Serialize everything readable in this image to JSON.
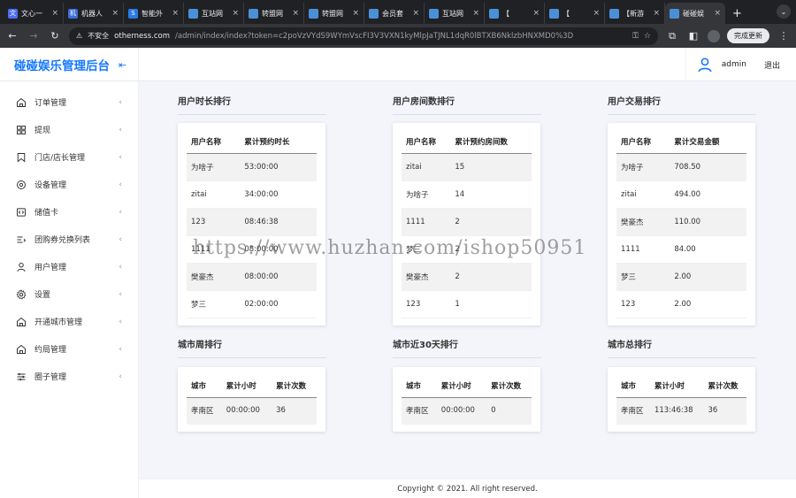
{
  "browser": {
    "tabs": [
      {
        "label": "文心一",
        "color": "#4e6ef2",
        "glyph": "文"
      },
      {
        "label": "机器人",
        "color": "#3b6fd8",
        "glyph": "机"
      },
      {
        "label": "智能外",
        "color": "#2a7be4",
        "glyph": "S"
      },
      {
        "label": "互站网",
        "color": "#4a90d9",
        "glyph": ""
      },
      {
        "label": "转盟网",
        "color": "#4a90d9",
        "glyph": ""
      },
      {
        "label": "转盟网",
        "color": "#4a90d9",
        "glyph": ""
      },
      {
        "label": "会员套",
        "color": "#4a90d9",
        "glyph": ""
      },
      {
        "label": "互站网",
        "color": "#4a90d9",
        "glyph": ""
      },
      {
        "label": "【",
        "color": "#4a90d9",
        "glyph": ""
      },
      {
        "label": "【",
        "color": "#4a90d9",
        "glyph": ""
      },
      {
        "label": "【新游",
        "color": "#4a90d9",
        "glyph": ""
      },
      {
        "label": "碰碰娱",
        "color": "#4a90d9",
        "glyph": ""
      }
    ],
    "new_tab": "+",
    "insecure_label": "不安全",
    "url_host": "otherness.com",
    "url_rest": "/admin/index/index?token=c2poVzVYdS9WYmVscFI3V3VXN1kyMlpJaTJNL1dqR0lBTXB6NklzbHNXMD0%3D",
    "update_label": "完成更新"
  },
  "header": {
    "brand": "碰碰娱乐管理后台",
    "user_name": "admin",
    "logout": "退出"
  },
  "sidebar": {
    "items": [
      {
        "label": "订单管理",
        "icon": "home-icon"
      },
      {
        "label": "提现",
        "icon": "grid-icon"
      },
      {
        "label": "门店/店长管理",
        "icon": "bookmark-icon"
      },
      {
        "label": "设备管理",
        "icon": "target-icon"
      },
      {
        "label": "储值卡",
        "icon": "code-icon"
      },
      {
        "label": "团购券兑换列表",
        "icon": "list-icon"
      },
      {
        "label": "用户管理",
        "icon": "user-icon"
      },
      {
        "label": "设置",
        "icon": "gear-icon"
      },
      {
        "label": "开通城市管理",
        "icon": "home-icon"
      },
      {
        "label": "约局管理",
        "icon": "home-icon"
      },
      {
        "label": "圈子管理",
        "icon": "sliders-icon"
      }
    ]
  },
  "sections": {
    "user_hours": {
      "title": "用户时长排行",
      "headers": [
        "用户名称",
        "累计预约时长"
      ],
      "rows": [
        [
          "为啥子",
          "53:00:00"
        ],
        [
          "zitai",
          "34:00:00"
        ],
        [
          "123",
          "08:46:38"
        ],
        [
          "1111",
          "08:00:00"
        ],
        [
          "樊豪杰",
          "08:00:00"
        ],
        [
          "梦三",
          "02:00:00"
        ]
      ]
    },
    "user_rooms": {
      "title": "用户房间数排行",
      "headers": [
        "用户名称",
        "累计预约房间数"
      ],
      "rows": [
        [
          "zitai",
          "15"
        ],
        [
          "为啥子",
          "14"
        ],
        [
          "1111",
          "2"
        ],
        [
          "梦三",
          "2"
        ],
        [
          "樊豪杰",
          "2"
        ],
        [
          "123",
          "1"
        ]
      ]
    },
    "user_trades": {
      "title": "用户交易排行",
      "headers": [
        "用户名称",
        "累计交易金额"
      ],
      "rows": [
        [
          "为啥子",
          "708.50"
        ],
        [
          "zitai",
          "494.00"
        ],
        [
          "樊豪杰",
          "110.00"
        ],
        [
          "1111",
          "84.00"
        ],
        [
          "梦三",
          "2.00"
        ],
        [
          "123",
          "2.00"
        ]
      ]
    },
    "city_week": {
      "title": "城市周排行",
      "headers": [
        "城市",
        "累计小时",
        "累计次数"
      ],
      "rows": [
        [
          "孝南区",
          "00:00:00",
          "36"
        ]
      ]
    },
    "city_30days": {
      "title": "城市近30天排行",
      "headers": [
        "城市",
        "累计小时",
        "累计次数"
      ],
      "rows": [
        [
          "孝南区",
          "00:00:00",
          "0"
        ]
      ]
    },
    "city_total": {
      "title": "城市总排行",
      "headers": [
        "城市",
        "累计小时",
        "累计次数"
      ],
      "rows": [
        [
          "孝南区",
          "113:46:38",
          "36"
        ]
      ]
    }
  },
  "footer": "Copyright © 2021. All right reserved.",
  "watermark": "https://www.huzhan.com/ishop50951",
  "colors": {
    "accent": "#1677ff",
    "stripe": "#f2f2f2",
    "page_bg": "#f3f5fb"
  }
}
